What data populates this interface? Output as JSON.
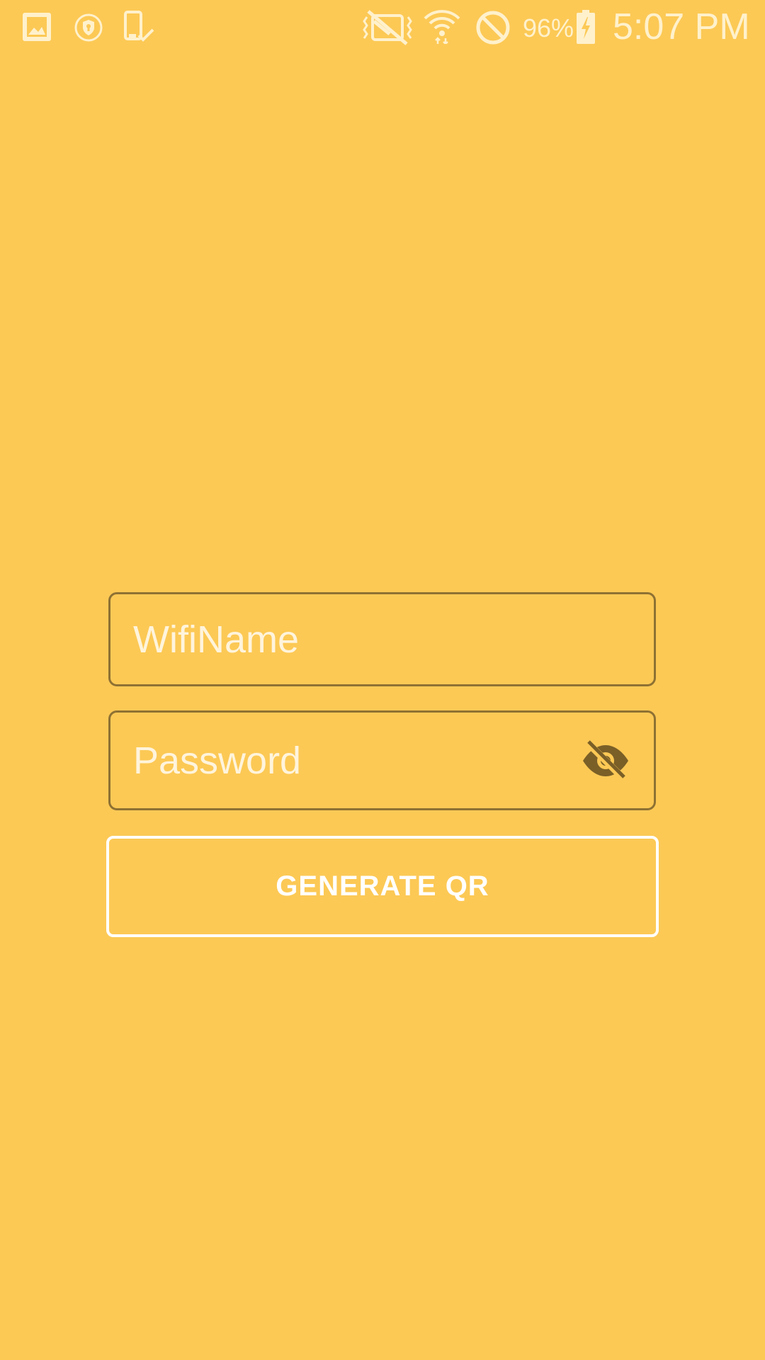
{
  "status_bar": {
    "battery_percent": "96%",
    "time": "5:07 PM",
    "icons": [
      "gallery-icon",
      "vpn-shield-icon",
      "device-check-icon",
      "vibrate-mute-icon",
      "wifi-icon",
      "do-not-disturb-icon",
      "battery-charging-icon"
    ]
  },
  "form": {
    "wifi_name_placeholder": "WifiName",
    "password_placeholder": "Password",
    "password_visibility_icon": "eye-off-icon",
    "generate_label": "GENERATE QR"
  },
  "colors": {
    "background": "#FCC955",
    "field_border": "#8E7133",
    "button_border": "#FFFFFF",
    "eye_icon": "#7A5F27"
  }
}
